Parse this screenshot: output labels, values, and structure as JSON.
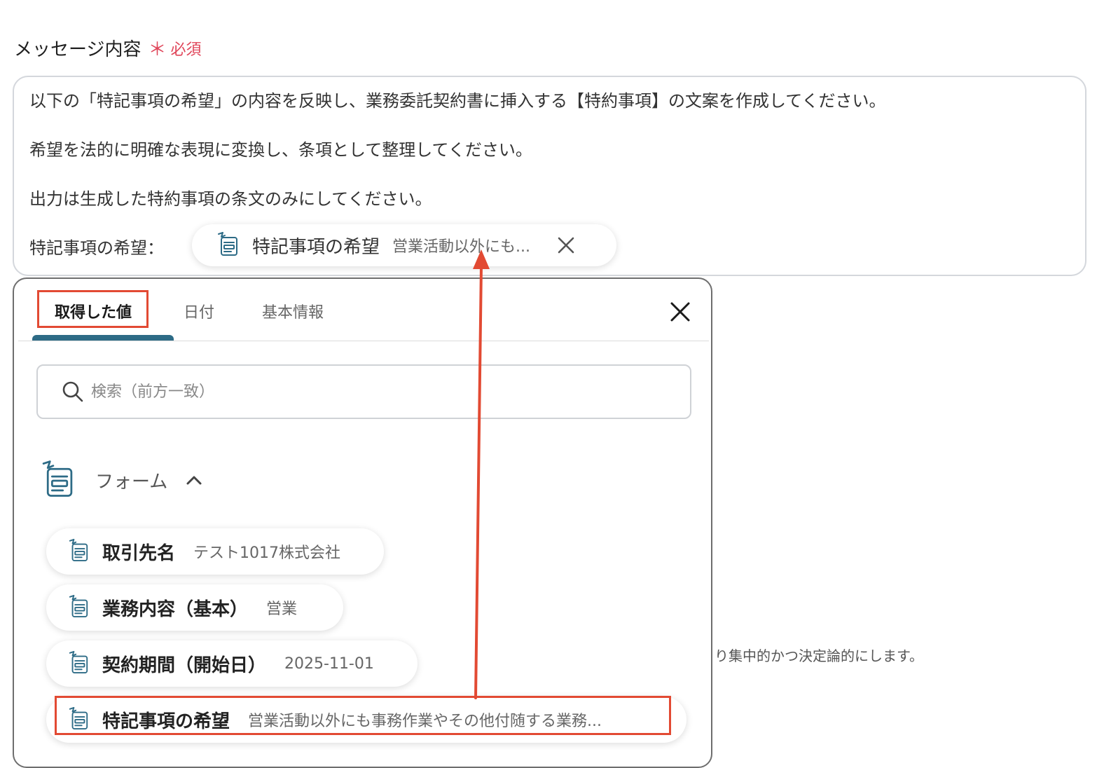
{
  "field": {
    "label": "メッセージ内容",
    "required_mark": "＊",
    "required_text": "必須"
  },
  "message": {
    "line1": "以下の「特記事項の希望」の内容を反映し、業務委託契約書に挿入する【特約事項】の文案を作成してください。",
    "line2": "希望を法的に明確な表現に変換し、条項として整理してください。",
    "line3": "出力は生成した特約事項の条文のみにしてください。",
    "line4_prefix": "特記事項の希望：",
    "chip": {
      "name": "特記事項の希望",
      "value": "営業活動以外にも..."
    }
  },
  "popup": {
    "tabs": [
      {
        "label": "取得した値",
        "active": true
      },
      {
        "label": "日付",
        "active": false
      },
      {
        "label": "基本情報",
        "active": false
      }
    ],
    "search": {
      "placeholder": "検索（前方一致）",
      "value": ""
    },
    "group": {
      "label": "フォーム",
      "expanded": true
    },
    "items": [
      {
        "name": "取引先名",
        "value": "テスト1017株式会社"
      },
      {
        "name": "業務内容（基本）",
        "value": "営業"
      },
      {
        "name": "契約期間（開始日）",
        "value": "2025-11-01"
      },
      {
        "name": "特記事項の希望",
        "value": "営業活動以外にも事務作業やその他付随する業務..."
      }
    ]
  },
  "background_text": "り集中的かつ決定論的にします。",
  "colors": {
    "accent": "#2d6b86",
    "required": "#e0465a",
    "annotation": "#e24a33"
  },
  "icons": {
    "form": "form-icon",
    "close": "close-icon",
    "search": "search-icon",
    "chevron": "chevron-up-icon"
  }
}
